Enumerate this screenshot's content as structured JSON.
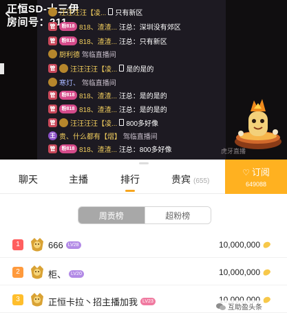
{
  "room": {
    "title": "正恒SD-十三伊",
    "number": "房间号：211"
  },
  "chat": {
    "messages": [
      {
        "badge": "crest",
        "name": "汪汪汪汪【凌...",
        "text": "只有新区",
        "phone": true
      },
      {
        "badge": "guan",
        "extra": "粉818",
        "name": "818、渣渣...",
        "text": "汪总：深圳没有郊区"
      },
      {
        "badge": "guan",
        "extra": "粉818",
        "name": "818、渣渣...",
        "text": "汪总：只有新区"
      },
      {
        "badge": "crest",
        "name": "厨利德",
        "text": "驾临直播间",
        "dim": true
      },
      {
        "badge": "guan",
        "name": "汪汪汪汪【凌...",
        "text": "是的是的",
        "phone": true
      },
      {
        "badge": "crest",
        "name": "寒灯、",
        "text": "驾临直播间",
        "dim": true
      },
      {
        "badge": "guan",
        "extra": "粉818",
        "name": "818、渣渣...",
        "text": "汪总：是的是的"
      },
      {
        "badge": "guan",
        "extra": "粉818",
        "name": "818、渣渣...",
        "text": "汪总：是的是的"
      },
      {
        "badge": "crest",
        "name": "汪汪汪汪【凌...",
        "text": "800多好像",
        "phone": true
      },
      {
        "badge": "purple",
        "name": "贵、什么都有【熠】",
        "text": "驾临直播间",
        "dim": true
      },
      {
        "badge": "guan",
        "extra": "粉818",
        "name": "818、渣渣...",
        "text": "汪总：800多好像"
      }
    ],
    "watermark": "虎牙直播"
  },
  "tabs": {
    "chat": "聊天",
    "host": "主播",
    "rank": "排行",
    "vip": "贵宾",
    "vip_count": "(655)"
  },
  "subscribe": {
    "label": "订阅",
    "count": "649088"
  },
  "segment": {
    "weekly": "周贡榜",
    "super_fans": "超粉榜",
    "selected": "周贡榜"
  },
  "ranking": [
    {
      "rank": "1",
      "name": "666",
      "level": "LV28",
      "score": "10,000,000"
    },
    {
      "rank": "2",
      "name": "柜、",
      "level": "LV20",
      "score": "10,000,000"
    },
    {
      "rank": "3",
      "name": "正恒卡拉丶招主播加我",
      "level": "LV23",
      "score": "10,000,000"
    }
  ],
  "wechat_mark": "互助盈头条",
  "colors": {
    "accent": "#ffb120",
    "rank1": "#ff5f5f",
    "rank2": "#ff9a3c",
    "rank3": "#ffbe2c"
  }
}
